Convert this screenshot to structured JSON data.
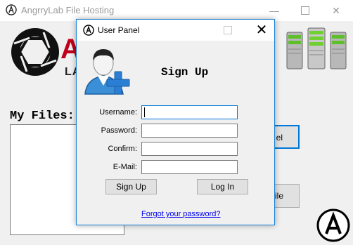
{
  "main_window": {
    "title": "AngrryLab File Hosting",
    "logo_text_a": "A",
    "logo_text_la": "LA",
    "my_files_label": "My Files:",
    "panel_button_partial": "el",
    "file_button_partial": "ile"
  },
  "dialog": {
    "title": "User Panel",
    "heading": "Sign Up",
    "fields": {
      "username_label": "Username:",
      "password_label": "Password:",
      "confirm_label": "Confirm:",
      "email_label": "E-Mail:"
    },
    "values": {
      "username": "",
      "password": "",
      "confirm": "",
      "email": ""
    },
    "signup_button": "Sign Up",
    "login_button": "Log In",
    "forgot_link": "Forgot your password?"
  },
  "icons": {
    "app_icon": "aperture-logo-icon",
    "user_icon": "user-add-icon",
    "server_icon": "server-rack-icon"
  },
  "colors": {
    "accent": "#0078d7",
    "link": "#0000ee",
    "logo_red": "#c0001a"
  }
}
